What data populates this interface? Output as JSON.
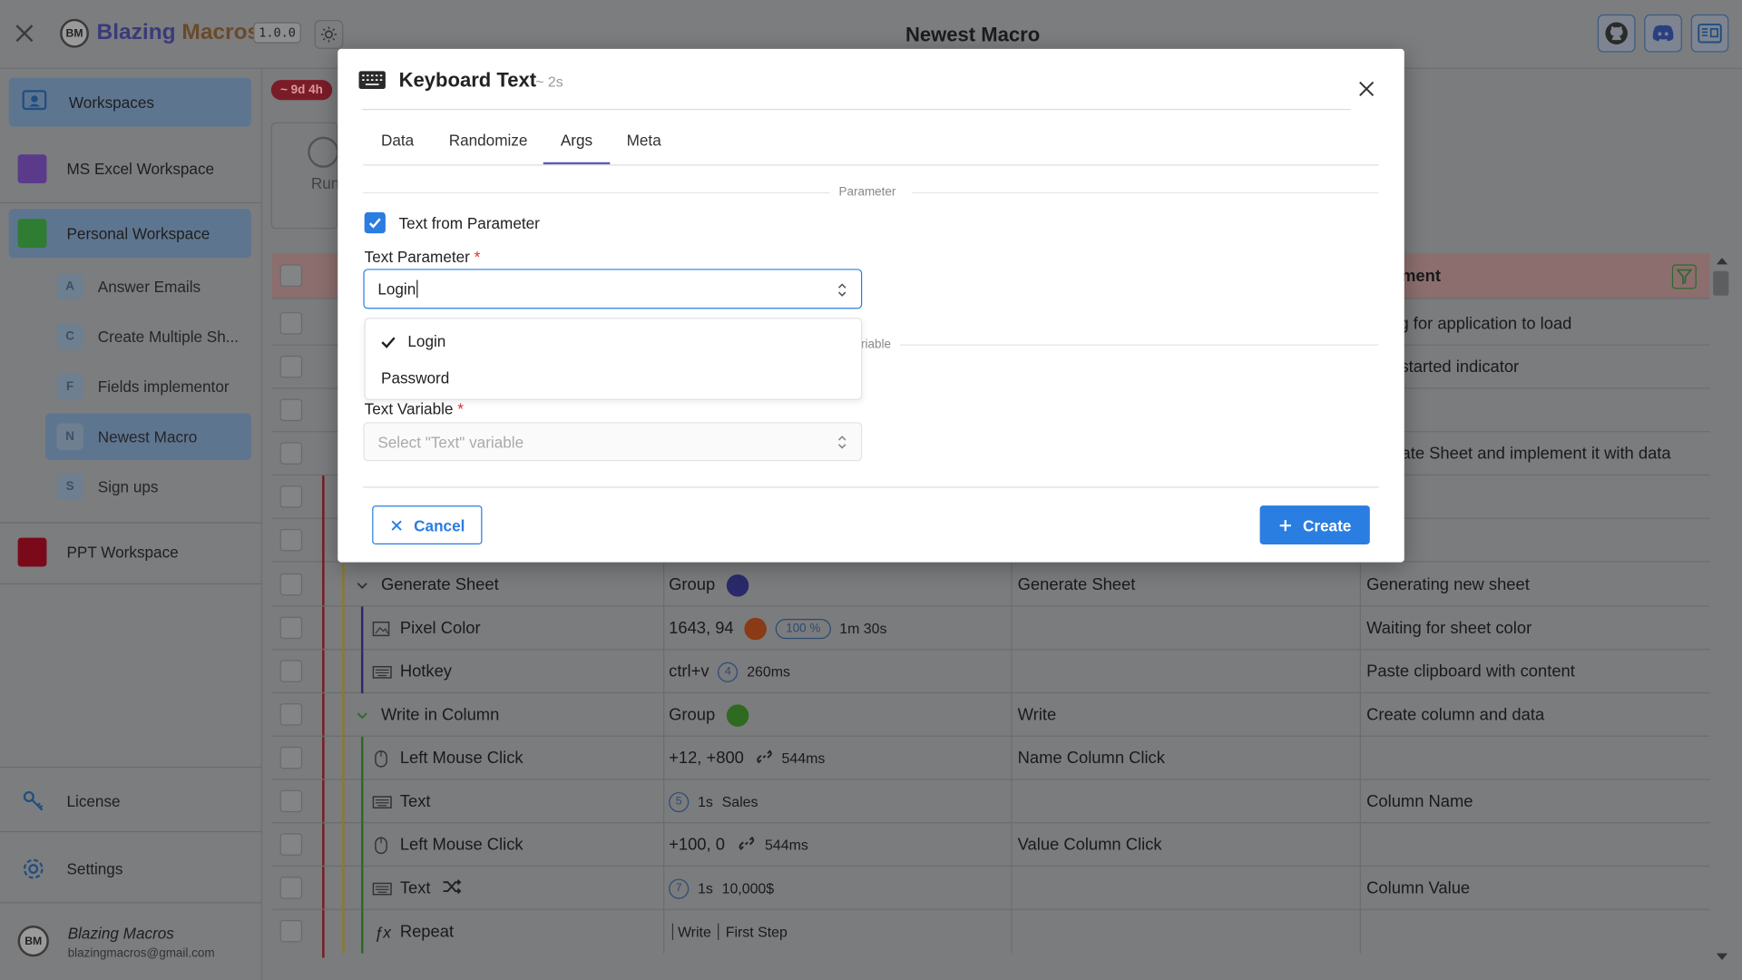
{
  "app": {
    "brand_part1": "Blazing ",
    "brand_part2": "Macros",
    "version": "1.0.0",
    "logo_text": "BM",
    "page_title": "Newest Macro"
  },
  "sidebar": {
    "workspaces_label": "Workspaces",
    "items": [
      {
        "label": "MS Excel Workspace",
        "color": "#5a3a8a"
      },
      {
        "label": "Personal Workspace",
        "color": "#2e7d32"
      },
      {
        "label": "PPT Workspace",
        "color": "#7a0a1a"
      }
    ],
    "macros": [
      {
        "letter": "A",
        "label": "Answer Emails"
      },
      {
        "letter": "C",
        "label": "Create Multiple Sh..."
      },
      {
        "letter": "F",
        "label": "Fields implementor"
      },
      {
        "letter": "N",
        "label": "Newest Macro"
      },
      {
        "letter": "S",
        "label": "Sign ups"
      }
    ],
    "license": "License",
    "settings": "Settings",
    "user_name": "Blazing Macros",
    "user_email": "blazingmacros@gmail.com"
  },
  "main": {
    "badge": "~ 9d 4h",
    "run_label": "Run",
    "comment_header": "ment",
    "bg_rows": [
      {
        "comment": "ing for application to load"
      },
      {
        "comment": "o started indicator"
      },
      {
        "comment": ""
      },
      {
        "comment": "erate Sheet and implement it with data"
      }
    ],
    "rows": [
      {
        "name": "Generate Sheet",
        "value": "Group",
        "label": "Generate Sheet",
        "comment": "Generating new sheet"
      },
      {
        "name": "Pixel Color",
        "value": "1643, 94",
        "pct": "100 %",
        "time": "1m 30s",
        "label": "",
        "comment": "Waiting for sheet color"
      },
      {
        "name": "Hotkey",
        "value": "ctrl+v",
        "num": "4",
        "time": "260ms",
        "label": "",
        "comment": "Paste clipboard with content"
      },
      {
        "name": "Write in Column",
        "value": "Group",
        "label": "Write",
        "comment": "Create column and data"
      },
      {
        "name": "Left Mouse Click",
        "value": "+12, +800",
        "time": "544ms",
        "label": "Name Column Click",
        "comment": ""
      },
      {
        "name": "Text",
        "num": "5",
        "time": "1s",
        "value": "Sales",
        "label": "",
        "comment": "Column Name"
      },
      {
        "name": "Left Mouse Click",
        "value": "+100, 0",
        "time": "544ms",
        "label": "Value Column Click",
        "comment": ""
      },
      {
        "name": "Text",
        "num": "7",
        "time": "1s",
        "value": "10,000$",
        "label": "",
        "comment": "Column Value"
      },
      {
        "name": "Repeat",
        "value_a": "Write",
        "value_b": "First Step",
        "label": "",
        "comment": ""
      }
    ]
  },
  "modal": {
    "title": "Keyboard Text",
    "duration": "~ 2s",
    "tabs": [
      "Data",
      "Randomize",
      "Args",
      "Meta"
    ],
    "section_parameter": "Parameter",
    "checkbox_label": "Text from Parameter",
    "param_label": "Text Parameter",
    "required": "*",
    "param_value": "Login",
    "options": [
      "Login",
      "Password"
    ],
    "section_variable_partial": "riable",
    "var_label": "Text Variable",
    "var_placeholder": "Select \"Text\" variable",
    "cancel": "Cancel",
    "create": "Create"
  }
}
